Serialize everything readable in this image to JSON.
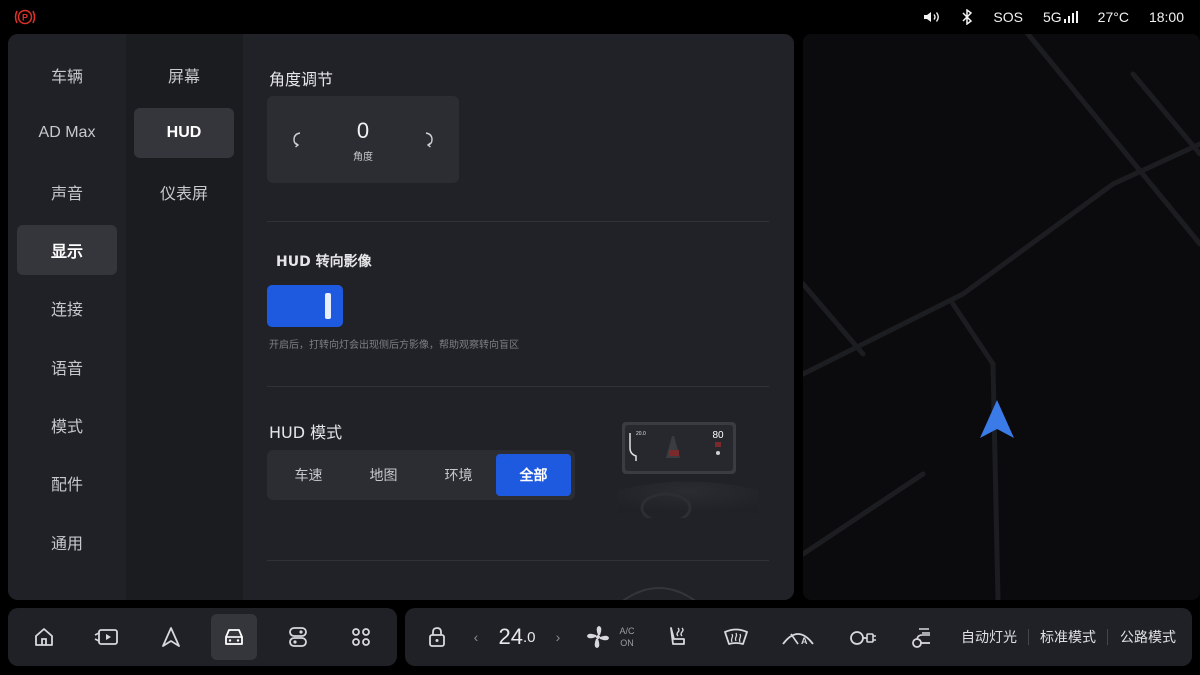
{
  "status": {
    "sos": "SOS",
    "network": "5G",
    "temperature": "27°C",
    "time": "18:00"
  },
  "settings": {
    "categories": [
      "车辆",
      "AD Max",
      "声音",
      "显示",
      "连接",
      "语音",
      "模式",
      "配件",
      "通用"
    ],
    "active_category": "显示",
    "subcategories": [
      "屏幕",
      "HUD",
      "仪表屏"
    ],
    "active_subcategory": "HUD",
    "angle": {
      "title": "角度调节",
      "value": "0",
      "label": "角度"
    },
    "hud_turn_image": {
      "title": "HUD 转向影像",
      "enabled": true,
      "description": "开启后，打转向灯会出现侧后方影像，帮助观察转向盲区"
    },
    "hud_mode": {
      "title": "HUD 模式",
      "options": [
        "车速",
        "地图",
        "环境",
        "全部"
      ],
      "selected": "全部",
      "preview": {
        "nav_distance": "20.0",
        "speed": "80"
      }
    }
  },
  "dock": {
    "apps": [
      "home-icon",
      "media-icon",
      "navigation-icon",
      "vehicle-icon",
      "controls-icon",
      "apps-grid-icon"
    ],
    "active_app": "vehicle-icon",
    "temperature_int": "24",
    "temperature_dec": ".0",
    "ac_line1": "A/C",
    "ac_line2": "ON",
    "quick": [
      "自动灯光",
      "标准模式",
      "公路模式"
    ]
  },
  "colors": {
    "accent": "#1e5ae0",
    "panel": "#1f2126",
    "active_item": "#34363c",
    "parking_brake": "#e0302a",
    "nav_arrow": "#3b7be8"
  }
}
